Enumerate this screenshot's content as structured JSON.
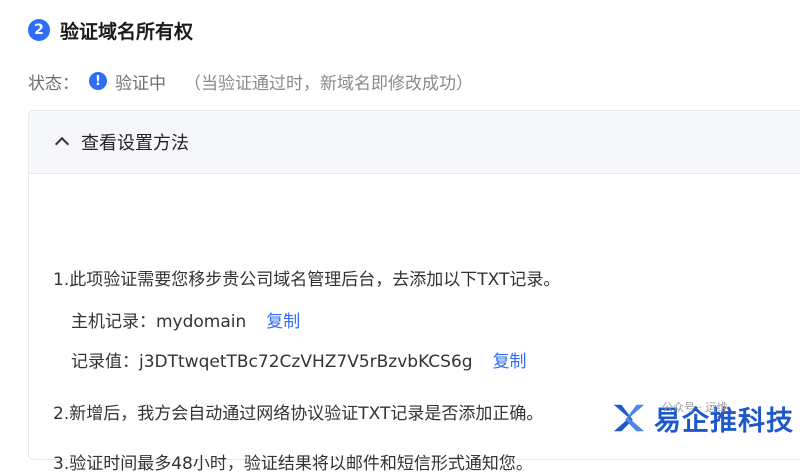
{
  "step": {
    "number": "2",
    "title": "验证域名所有权"
  },
  "status": {
    "label": "状态：",
    "icon": "info-icon",
    "icon_glyph": "!",
    "value": "验证中",
    "note": "（当验证通过时，新域名即修改成功）"
  },
  "panel": {
    "title": "查看设置方法",
    "line1": "1.此项验证需要您移步贵公司域名管理后台，去添加以下TXT记录。",
    "host_record": "主机记录：mydomain",
    "record_value": "记录值：j3DTtwqetTBc72CzVHZ7V5rBzvbKCS6g",
    "copy_label": "复制",
    "line2": "2.新增后，我方会自动通过网络协议验证TXT记录是否添加正确。",
    "line3": "3.验证时间最多48小时，验证结果将以邮件和短信形式通知您。"
  },
  "watermark": {
    "text": "易企推科技",
    "sub": "公众号 · 运维"
  },
  "colors": {
    "accent": "#2f6df6",
    "watermark": "#1f59c9",
    "panel_header_bg": "#f5f7fa"
  }
}
